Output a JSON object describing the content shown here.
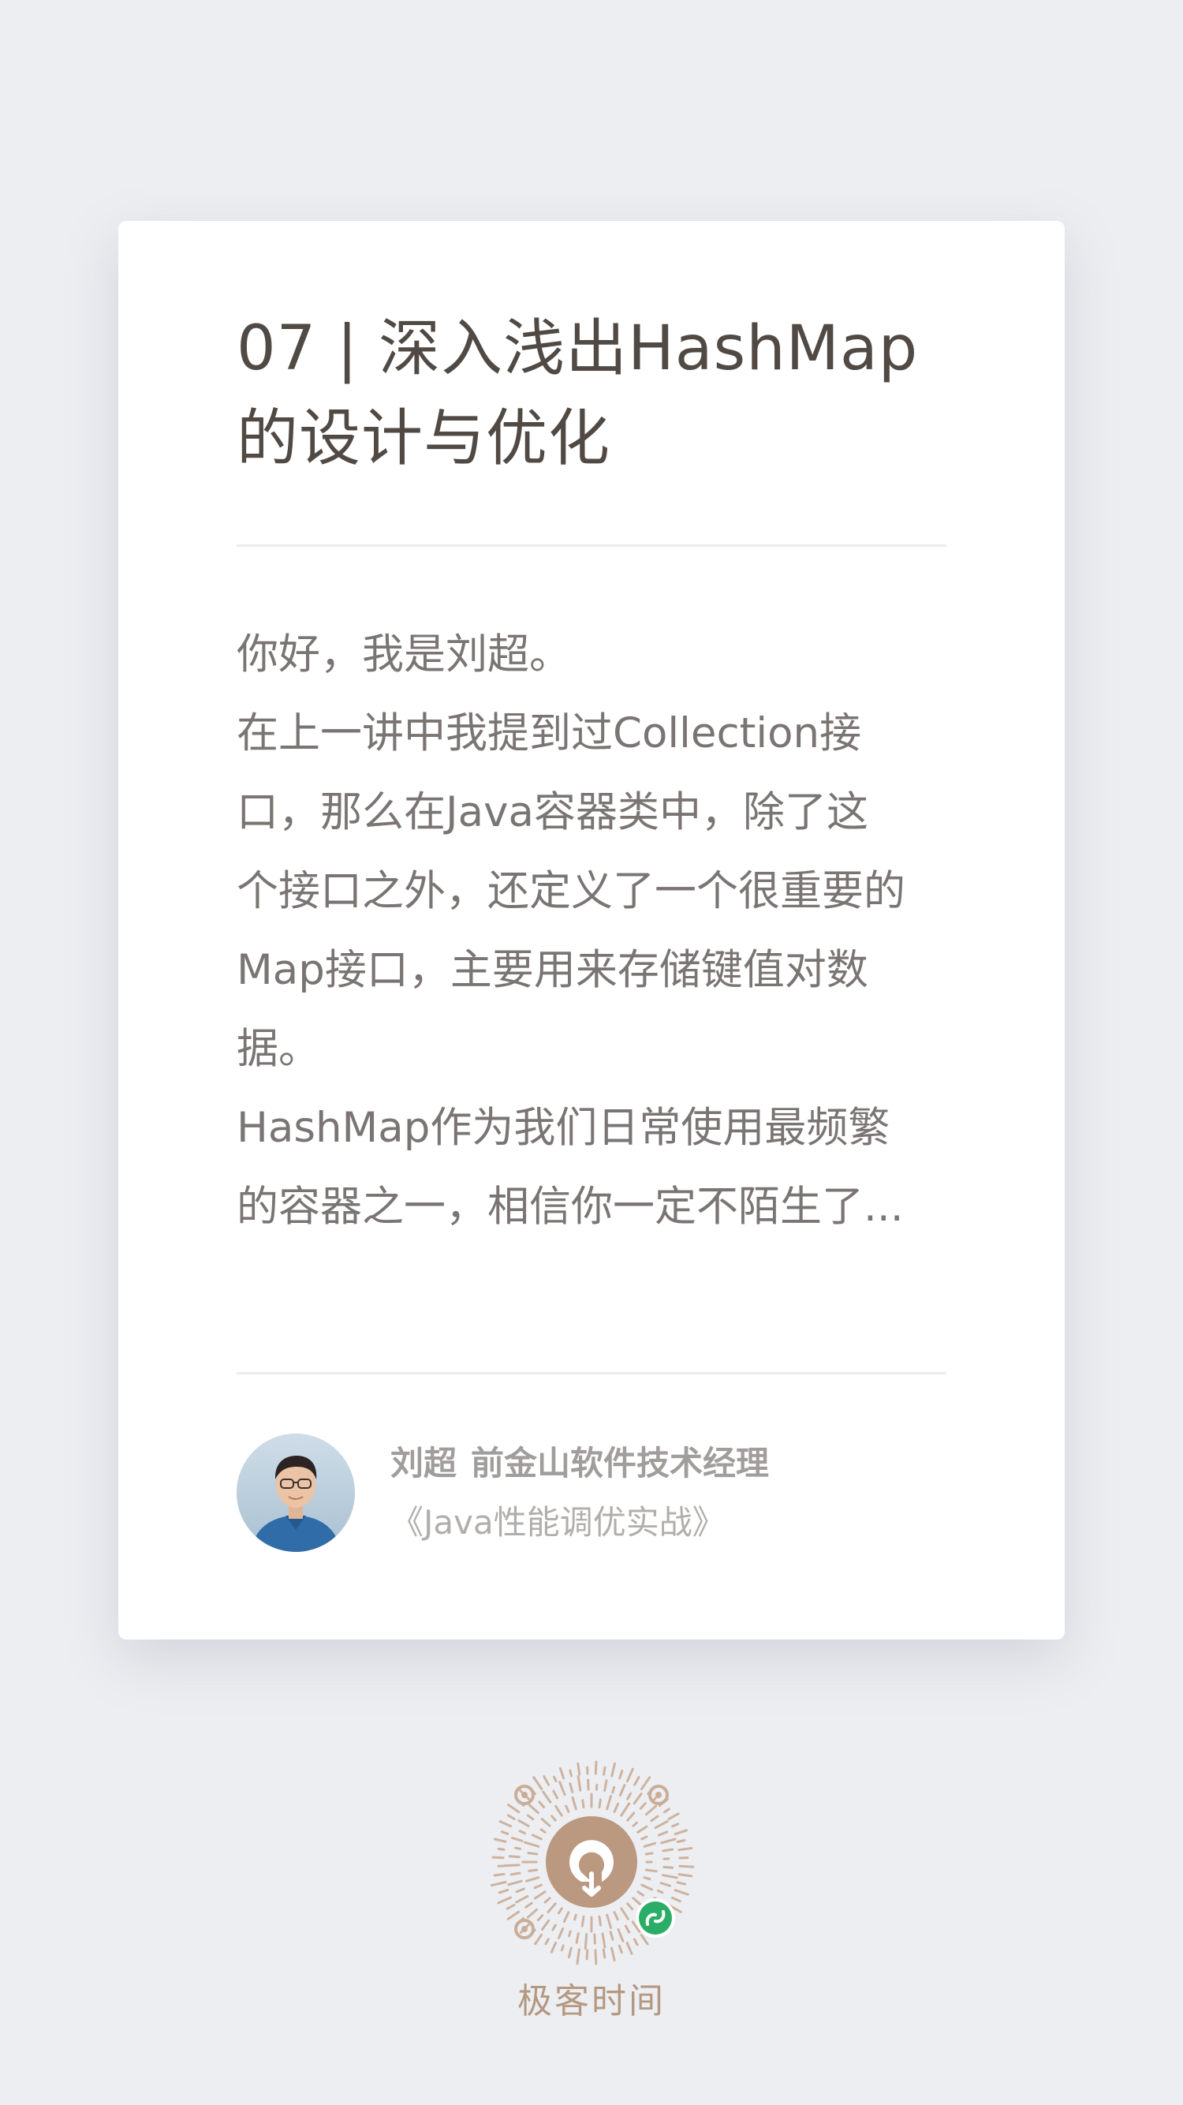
{
  "article": {
    "title_lines": [
      "07 | 深入浅出HashMap",
      "的设计与优化"
    ],
    "excerpt_lines": [
      "你好，我是刘超。",
      "在上一讲中我提到过Collection接",
      "口，那么在Java容器类中，除了这",
      "个接口之外，还定义了一个很重要的",
      "Map接口，主要用来存储键值对数",
      "据。",
      "HashMap作为我们日常使用最频繁",
      "的容器之一，相信你一定不陌生了..."
    ]
  },
  "author": {
    "name": "刘超",
    "role": "前金山软件技术经理",
    "course": "《Java性能调优实战》",
    "avatar_icon": "person-avatar"
  },
  "footer": {
    "qr_icon": "mini-program-code-icon",
    "brand": "极客时间"
  },
  "colors": {
    "background": "#edeef2",
    "card": "#ffffff",
    "title": "#514a44",
    "body_text": "#7a7573",
    "brand": "#b49880",
    "wechat_badge": "#2aae67"
  }
}
